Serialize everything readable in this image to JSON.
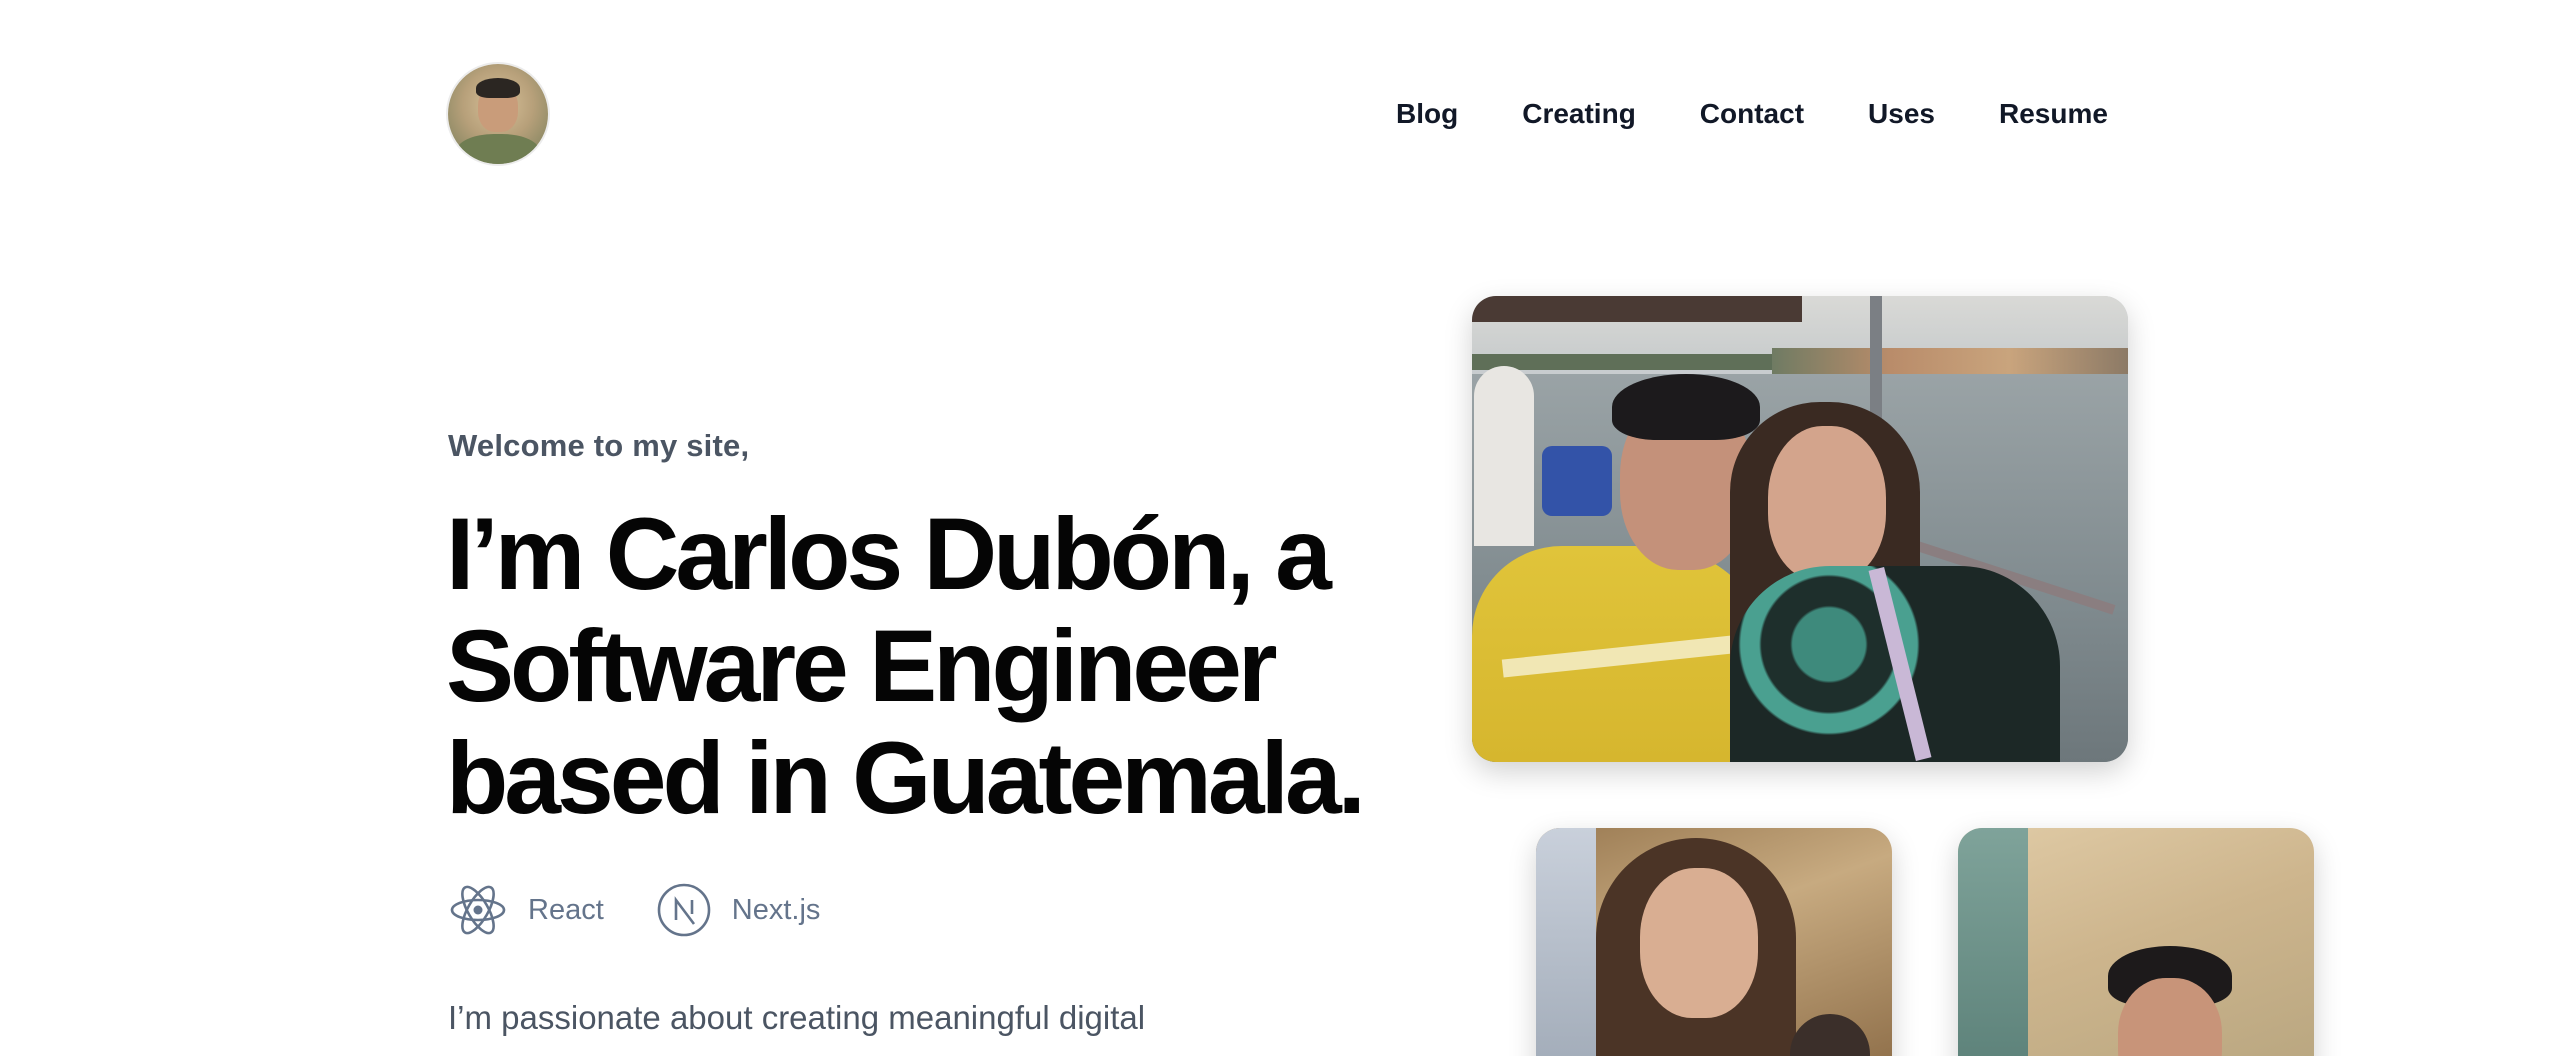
{
  "header": {
    "avatar_alt": "Carlos Dubón",
    "nav": [
      {
        "label": "Blog"
      },
      {
        "label": "Creating"
      },
      {
        "label": "Contact"
      },
      {
        "label": "Uses"
      },
      {
        "label": "Resume"
      }
    ]
  },
  "hero": {
    "welcome": "Welcome to my site,",
    "headline": "I’m Carlos Dubón, a Software Engineer based in Guatemala.",
    "tech": [
      {
        "icon": "react-icon",
        "label": "React"
      },
      {
        "icon": "nextjs-icon",
        "label": "Next.js"
      }
    ],
    "intro": "I’m passionate about creating meaningful digital"
  },
  "photos": {
    "main": "selfie-on-boat",
    "small_1": "selfie-woman",
    "small_2": "portrait-man"
  },
  "colors": {
    "text_primary": "#050505",
    "text_muted": "#4b5563",
    "tech_label": "#64748b",
    "background": "#ffffff"
  }
}
